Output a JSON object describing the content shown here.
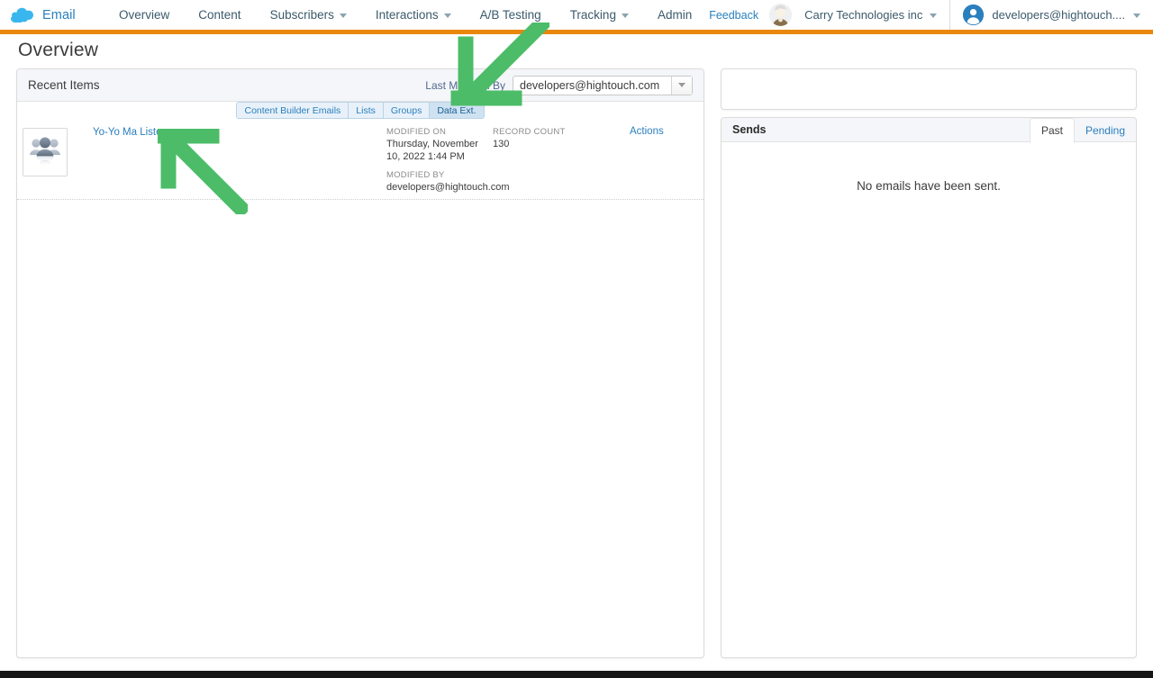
{
  "header": {
    "brand": {
      "label": "Email",
      "icon": "cloud-icon"
    },
    "nav_items": [
      {
        "label": "Overview",
        "has_menu": false
      },
      {
        "label": "Content",
        "has_menu": false
      },
      {
        "label": "Subscribers",
        "has_menu": true
      },
      {
        "label": "Interactions",
        "has_menu": true
      },
      {
        "label": "A/B Testing",
        "has_menu": false
      },
      {
        "label": "Tracking",
        "has_menu": true
      },
      {
        "label": "Admin",
        "has_menu": false
      }
    ],
    "feedback_label": "Feedback",
    "org_name": "Carry Technologies inc",
    "user_name": "developers@hightouch...."
  },
  "page": {
    "title": "Overview"
  },
  "recent_items": {
    "panel_title": "Recent Items",
    "filter_label": "Last Modified By",
    "filter_value": "developers@hightouch.com",
    "tabs": [
      {
        "label": "Content Builder Emails",
        "active": false
      },
      {
        "label": "Lists",
        "active": false
      },
      {
        "label": "Groups",
        "active": false
      },
      {
        "label": "Data Ext.",
        "active": true
      }
    ],
    "rows": [
      {
        "title": "Yo-Yo Ma Listeners",
        "thumb_icon": "people-group-icon",
        "modified_on_label": "MODIFIED ON",
        "modified_on_value": "Thursday, November 10, 2022 1:44 PM",
        "modified_by_label": "MODIFIED BY",
        "modified_by_value": "developers@hightouch.com",
        "record_count_label": "RECORD COUNT",
        "record_count_value": "130",
        "actions_label": "Actions"
      }
    ]
  },
  "sends": {
    "panel_title": "Sends",
    "tabs": [
      {
        "label": "Past",
        "active": true
      },
      {
        "label": "Pending",
        "active": false
      }
    ],
    "empty_message": "No emails have been sent."
  },
  "annotations": [
    {
      "name": "arrow-to-data-ext-tab",
      "direction": "down-left",
      "color": "#4cbc68"
    },
    {
      "name": "arrow-to-item-title",
      "direction": "up-left",
      "color": "#4cbc68"
    }
  ],
  "colors": {
    "accent_orange": "#e8870c",
    "link_blue": "#2a7fbd",
    "annotation_green": "#4cbc68",
    "panel_header_gray": "#f4f6f9"
  }
}
